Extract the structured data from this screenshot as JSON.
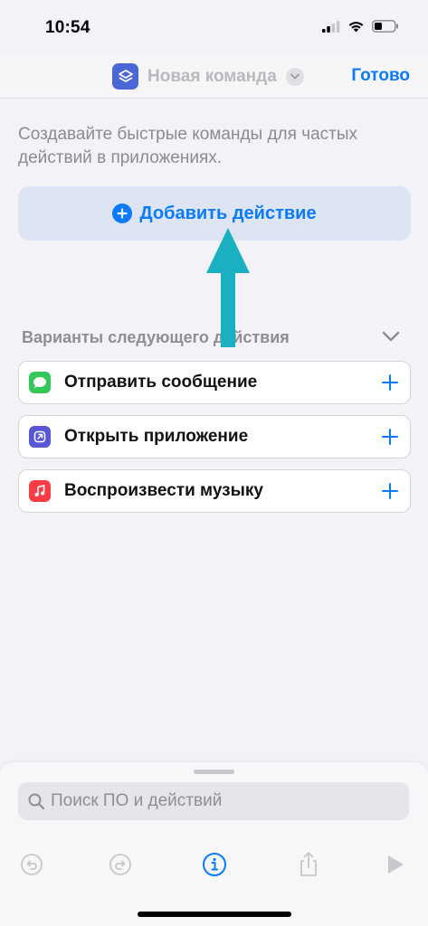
{
  "status_bar": {
    "time": "10:54"
  },
  "nav": {
    "title": "Новая команда",
    "done_label": "Готово"
  },
  "intro_text": "Создавайте быстрые команды для частых действий в приложениях.",
  "add_action": {
    "label": "Добавить действие"
  },
  "suggestions": {
    "title": "Варианты следующего действия",
    "items": [
      {
        "label": "Отправить сообщение",
        "icon": "messages-icon",
        "color": "#34c759"
      },
      {
        "label": "Открыть приложение",
        "icon": "open-app-icon",
        "color": "#5856d6"
      },
      {
        "label": "Воспроизвести музыку",
        "icon": "music-icon",
        "color": "#fc3c44"
      }
    ]
  },
  "search": {
    "placeholder": "Поиск ПО и действий"
  },
  "colors": {
    "accent": "#0a7aff",
    "arrow": "#1aafc1"
  }
}
